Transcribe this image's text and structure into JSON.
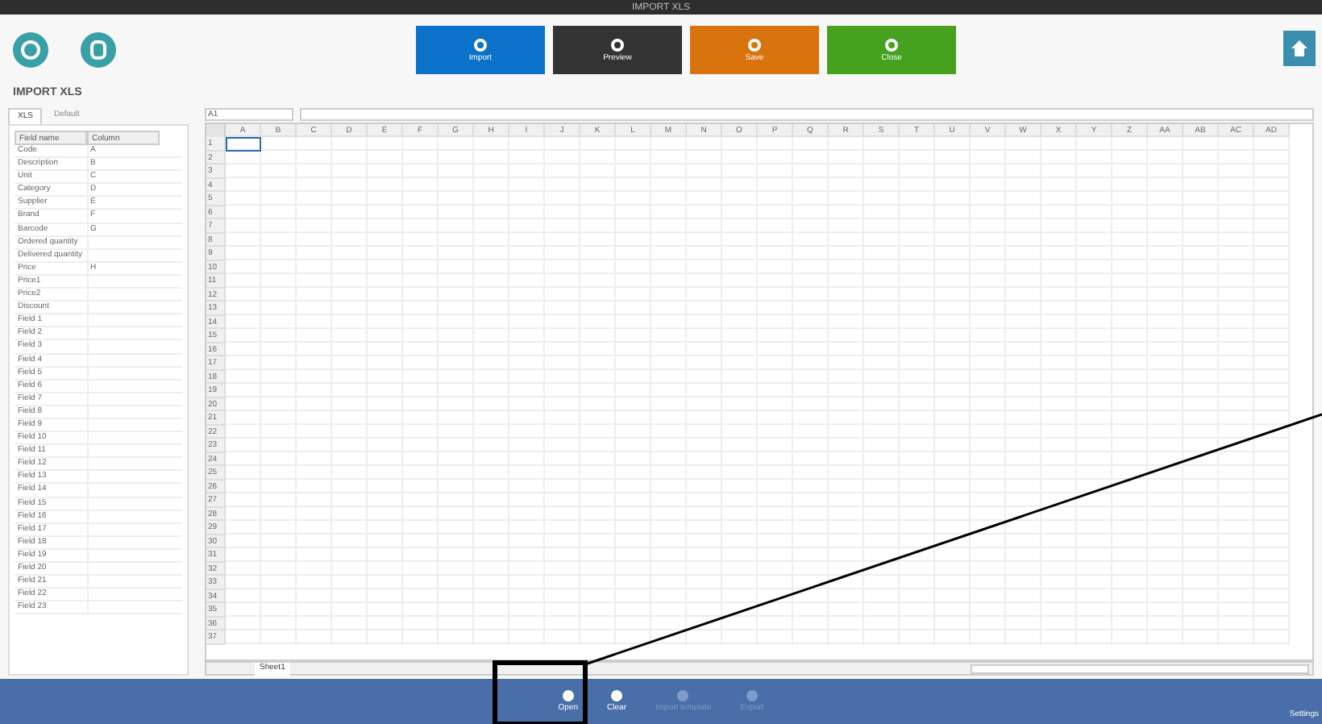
{
  "window": {
    "title": "IMPORT XLS"
  },
  "toolbar": {
    "buttons": [
      {
        "label": "Import",
        "color": "#0a72c9"
      },
      {
        "label": "Preview",
        "color": "#333333"
      },
      {
        "label": "Save",
        "color": "#d9730d"
      },
      {
        "label": "Close",
        "color": "#46a11e"
      }
    ]
  },
  "page_title": "IMPORT XLS",
  "left_tabs": [
    {
      "label": "XLS",
      "selected": true
    },
    {
      "label": "Default",
      "selected": false
    }
  ],
  "fields_table": {
    "columns": [
      "Field name",
      "Column"
    ],
    "rows": [
      [
        "Code",
        "A"
      ],
      [
        "Description",
        "B"
      ],
      [
        "Unit",
        "C"
      ],
      [
        "Category",
        "D"
      ],
      [
        "Supplier",
        "E"
      ],
      [
        "Brand",
        "F"
      ],
      [
        "Barcode",
        "G"
      ],
      [
        "Ordered quantity",
        ""
      ],
      [
        "Delivered quantity",
        ""
      ],
      [
        "Price",
        "H"
      ],
      [
        "Price1",
        ""
      ],
      [
        "Price2",
        ""
      ],
      [
        "Discount",
        ""
      ],
      [
        "Field 1",
        ""
      ],
      [
        "Field 2",
        ""
      ],
      [
        "Field 3",
        ""
      ],
      [
        "Field 4",
        ""
      ],
      [
        "Field 5",
        ""
      ],
      [
        "Field 6",
        ""
      ],
      [
        "Field 7",
        ""
      ],
      [
        "Field 8",
        ""
      ],
      [
        "Field 9",
        ""
      ],
      [
        "Field 10",
        ""
      ],
      [
        "Field 11",
        ""
      ],
      [
        "Field 12",
        ""
      ],
      [
        "Field 13",
        ""
      ],
      [
        "Field 14",
        ""
      ],
      [
        "Field 15",
        ""
      ],
      [
        "Field 16",
        ""
      ],
      [
        "Field 17",
        ""
      ],
      [
        "Field 18",
        ""
      ],
      [
        "Field 19",
        ""
      ],
      [
        "Field 20",
        ""
      ],
      [
        "Field 21",
        ""
      ],
      [
        "Field 22",
        ""
      ],
      [
        "Field 23",
        ""
      ]
    ]
  },
  "sheet": {
    "cell_ref": "A1",
    "columns": [
      "A",
      "B",
      "C",
      "D",
      "E",
      "F",
      "G",
      "H",
      "I",
      "J",
      "K",
      "L",
      "M",
      "N",
      "O",
      "P",
      "Q",
      "R",
      "S",
      "T",
      "U",
      "V",
      "W",
      "X",
      "Y",
      "Z",
      "AA",
      "AB",
      "AC",
      "AD"
    ],
    "row_count_labels": [
      "1",
      "2",
      "3",
      "4",
      "5",
      "6",
      "7",
      "8",
      "9",
      "10",
      "11",
      "12",
      "13",
      "14",
      "15",
      "16",
      "17",
      "18",
      "19",
      "20",
      "21",
      "22",
      "23",
      "24",
      "25",
      "26",
      "27",
      "28",
      "29",
      "30",
      "31",
      "32",
      "33",
      "34",
      "35",
      "36",
      "37"
    ],
    "tabs": [
      {
        "label": "Sheet1",
        "selected": true
      }
    ]
  },
  "bottom_bar": {
    "buttons": [
      {
        "label": "Open",
        "disabled": false
      },
      {
        "label": "Clear",
        "disabled": false
      },
      {
        "label": "Import template",
        "disabled": true
      },
      {
        "label": "Export",
        "disabled": true
      }
    ],
    "right_label": "Settings"
  }
}
